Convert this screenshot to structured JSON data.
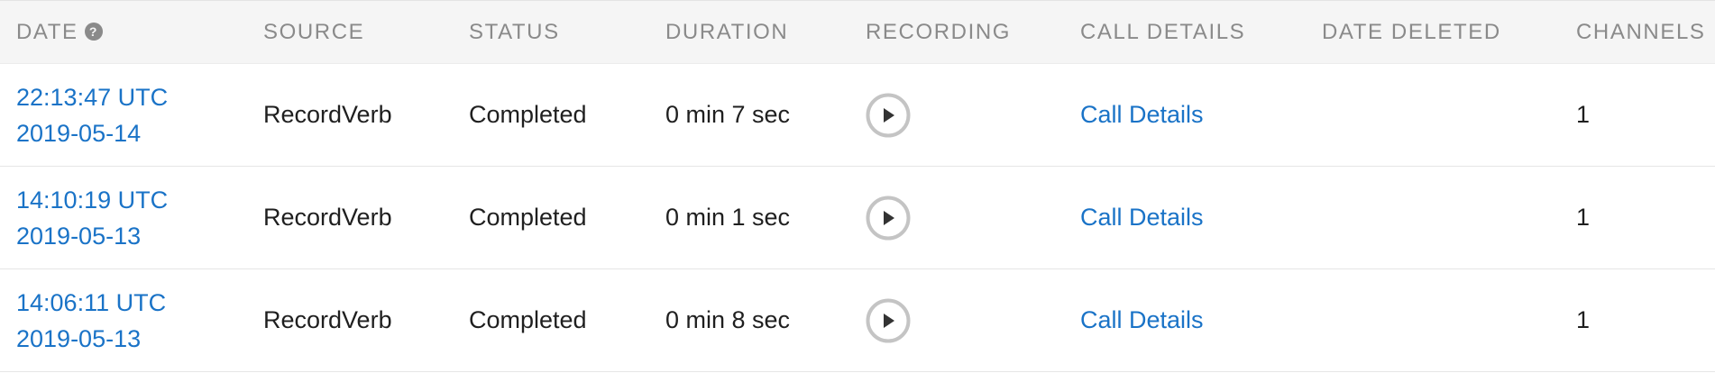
{
  "header": {
    "date": "DATE",
    "source": "SOURCE",
    "status": "STATUS",
    "duration": "DURATION",
    "recording": "RECORDING",
    "call_details": "CALL DETAILS",
    "date_deleted": "DATE DELETED",
    "channels": "CHANNELS"
  },
  "colors": {
    "link": "#1a73c7",
    "header_bg": "#f5f5f5",
    "header_text": "#8a8a8a",
    "play_icon": "#c4c4c4"
  },
  "icons": {
    "help": "question-circle",
    "play": "play-circle"
  },
  "rows": [
    {
      "time": "22:13:47 UTC",
      "date": "2019-05-14",
      "source": "RecordVerb",
      "status": "Completed",
      "duration": "0 min 7 sec",
      "call_details": "Call Details",
      "date_deleted": "",
      "channels": "1"
    },
    {
      "time": "14:10:19 UTC",
      "date": "2019-05-13",
      "source": "RecordVerb",
      "status": "Completed",
      "duration": "0 min 1 sec",
      "call_details": "Call Details",
      "date_deleted": "",
      "channels": "1"
    },
    {
      "time": "14:06:11 UTC",
      "date": "2019-05-13",
      "source": "RecordVerb",
      "status": "Completed",
      "duration": "0 min 8 sec",
      "call_details": "Call Details",
      "date_deleted": "",
      "channels": "1"
    }
  ]
}
